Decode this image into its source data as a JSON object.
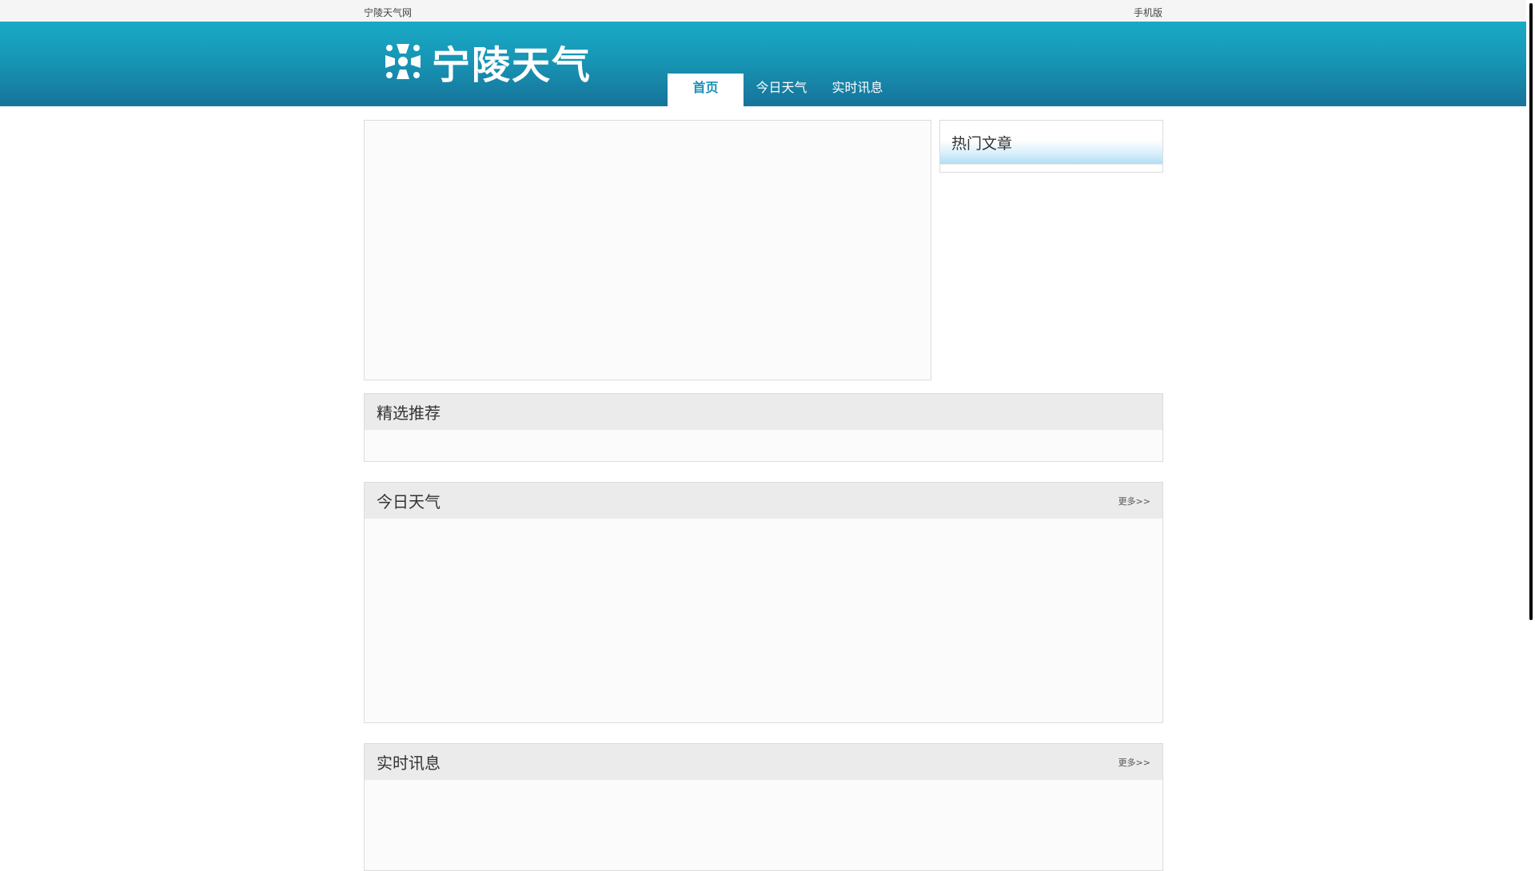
{
  "topbar": {
    "site_name": "宁陵天气网",
    "mobile_label": "手机版"
  },
  "header": {
    "logo_text": "宁陵天气",
    "logo_icon": "logo-mark-icon",
    "nav": [
      {
        "label": "首页",
        "active": true
      },
      {
        "label": "今日天气",
        "active": false
      },
      {
        "label": "实时讯息",
        "active": false
      }
    ]
  },
  "sidebar": {
    "hot_title": "热门文章"
  },
  "sections": {
    "featured": {
      "title": "精选推荐"
    },
    "weather": {
      "title": "今日天气",
      "more": "更多>>"
    },
    "news": {
      "title": "实时讯息",
      "more": "更多>>"
    }
  },
  "colors": {
    "header_top": "#18aac6",
    "header_bottom": "#17739a",
    "nav_active_text": "#1a8fb3"
  }
}
